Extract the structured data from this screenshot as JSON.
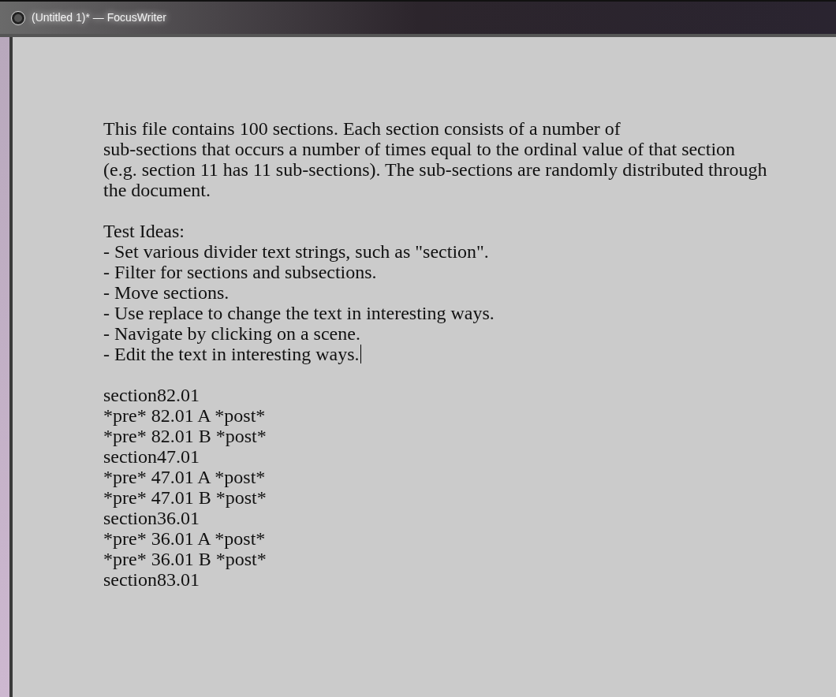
{
  "window": {
    "title": "(Untitled 1)* — FocusWriter"
  },
  "document": {
    "lines": [
      {
        "kind": "text",
        "text": "This file contains 100 sections. Each section consists of a number of"
      },
      {
        "kind": "text",
        "text": "sub-sections that occurs a number of times equal to the ordinal value of that section"
      },
      {
        "kind": "text",
        "text": "(e.g. section 11 has 11 sub-sections). The sub-sections are randomly distributed through"
      },
      {
        "kind": "text",
        "text": "the document."
      },
      {
        "kind": "blank"
      },
      {
        "kind": "text",
        "text": "Test Ideas:"
      },
      {
        "kind": "text",
        "text": "- Set various divider text strings, such as \"section\"."
      },
      {
        "kind": "text",
        "text": "- Filter for sections and subsections."
      },
      {
        "kind": "text",
        "text": "- Move sections."
      },
      {
        "kind": "text",
        "text": "- Use replace to change the text in interesting ways."
      },
      {
        "kind": "text",
        "text": "- Navigate by clicking on a scene."
      },
      {
        "kind": "text",
        "text": "- Edit the text in interesting ways.",
        "cursor": true
      },
      {
        "kind": "blank"
      },
      {
        "kind": "text",
        "text": "section82.01"
      },
      {
        "kind": "text",
        "text": "*pre* 82.01 A *post*"
      },
      {
        "kind": "text",
        "text": "*pre* 82.01 B *post*"
      },
      {
        "kind": "text",
        "text": "section47.01"
      },
      {
        "kind": "text",
        "text": "*pre* 47.01 A *post*"
      },
      {
        "kind": "text",
        "text": "*pre* 47.01 B *post*"
      },
      {
        "kind": "text",
        "text": "section36.01"
      },
      {
        "kind": "text",
        "text": "*pre* 36.01 A *post*"
      },
      {
        "kind": "text",
        "text": "*pre* 36.01 B *post*"
      },
      {
        "kind": "text",
        "text": "section83.01"
      }
    ]
  }
}
